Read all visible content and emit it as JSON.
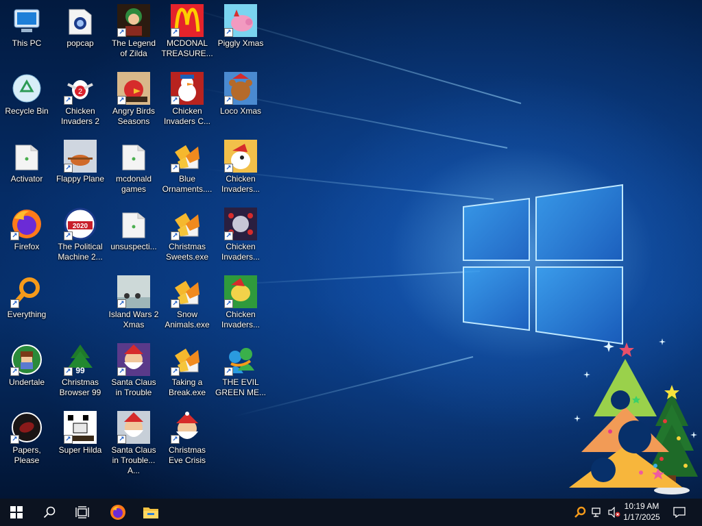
{
  "desktop": {
    "icons": [
      {
        "label": "This PC",
        "kind": "pc",
        "shortcut": false
      },
      {
        "label": "popcap",
        "kind": "folder-pop",
        "shortcut": false
      },
      {
        "label": "The Legend of Zilda",
        "kind": "zilda",
        "shortcut": true
      },
      {
        "label": "MCDONAL TREASURE...",
        "kind": "mcd",
        "shortcut": true
      },
      {
        "label": "Piggly Xmas",
        "kind": "pig",
        "shortcut": true
      },
      {
        "label": "Recycle Bin",
        "kind": "recycle",
        "shortcut": false
      },
      {
        "label": "Chicken Invaders 2",
        "kind": "chicken2",
        "shortcut": true
      },
      {
        "label": "Angry Birds Seasons",
        "kind": "angry",
        "shortcut": true
      },
      {
        "label": "Chicken Invaders C...",
        "kind": "snowman",
        "shortcut": true
      },
      {
        "label": "Loco Xmas",
        "kind": "bear",
        "shortcut": true
      },
      {
        "label": "Activator",
        "kind": "folder",
        "shortcut": false
      },
      {
        "label": "Flappy Plane",
        "kind": "flappy",
        "shortcut": true
      },
      {
        "label": "mcdonald games",
        "kind": "folder",
        "shortcut": false
      },
      {
        "label": "Blue Ornaments....",
        "kind": "setup",
        "shortcut": true
      },
      {
        "label": "Chicken Invaders...",
        "kind": "chicken-santa",
        "shortcut": true
      },
      {
        "label": "Firefox",
        "kind": "firefox",
        "shortcut": true
      },
      {
        "label": "The Political Machine 2...",
        "kind": "political",
        "shortcut": true
      },
      {
        "label": "unsuspecti...",
        "kind": "folder",
        "shortcut": false
      },
      {
        "label": "Christmas Sweets.exe",
        "kind": "setup",
        "shortcut": true
      },
      {
        "label": "Chicken Invaders...",
        "kind": "chicken-space",
        "shortcut": true
      },
      {
        "label": "Everything",
        "kind": "everything",
        "shortcut": true
      },
      {
        "label": "Island Wars 2 Xmas",
        "kind": "island",
        "shortcut": true
      },
      {
        "label": "Snow Animals.exe",
        "kind": "setup",
        "shortcut": true
      },
      {
        "label": "Chicken Invaders...",
        "kind": "chicken-green",
        "shortcut": true
      },
      {
        "label": "Undertale",
        "kind": "undertale",
        "shortcut": true
      },
      {
        "label": "Christmas Browser 99",
        "kind": "tree99",
        "shortcut": true
      },
      {
        "label": "Santa Claus in Trouble",
        "kind": "santa1",
        "shortcut": true
      },
      {
        "label": "Taking a Break.exe",
        "kind": "setup",
        "shortcut": true
      },
      {
        "label": "THE EVIL GREEN ME...",
        "kind": "msn",
        "shortcut": true
      },
      {
        "label": "Papers, Please",
        "kind": "papers",
        "shortcut": true
      },
      {
        "label": "Super Hilda",
        "kind": "hilda",
        "shortcut": true
      },
      {
        "label": "Santa Claus in Trouble... A...",
        "kind": "santa2",
        "shortcut": true
      },
      {
        "label": "Christmas Eve Crisis",
        "kind": "santa3",
        "shortcut": true
      }
    ]
  },
  "taskbar": {
    "start_icon": "windows-start-icon",
    "pinned": [
      "search-icon",
      "task-view-icon",
      "firefox-icon",
      "file-explorer-icon"
    ],
    "tray_icons": [
      "everything-search-icon",
      "network-icon",
      "volume-muted-icon"
    ],
    "time": "10:19 AM",
    "date": "1/17/2025",
    "notification_icon": "action-center-icon"
  },
  "colors": {
    "taskbar_bg": "#0c1320",
    "desktop_bg": "#052c66",
    "logo_blue": "#4db8ff"
  }
}
